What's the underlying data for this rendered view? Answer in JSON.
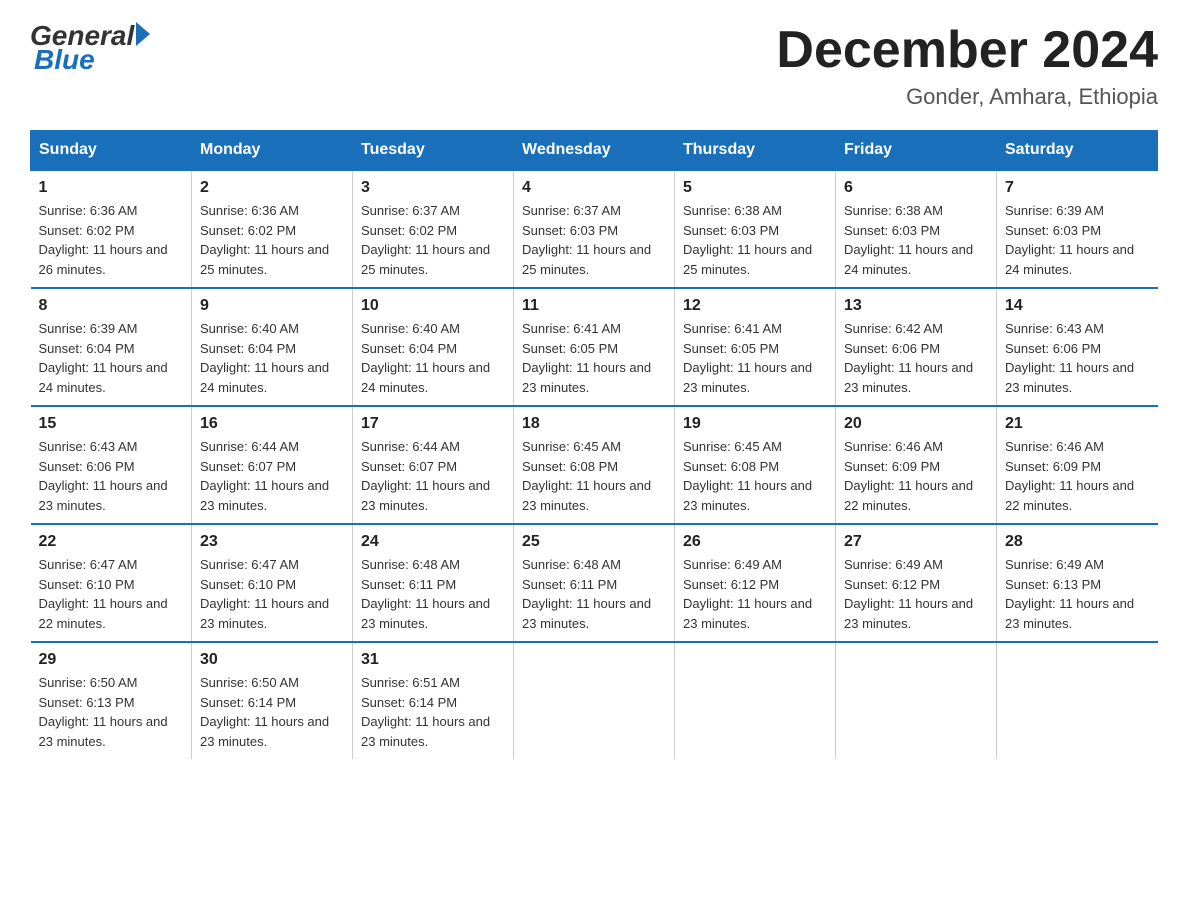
{
  "header": {
    "logo_general": "General",
    "logo_blue": "Blue",
    "month": "December 2024",
    "location": "Gonder, Amhara, Ethiopia"
  },
  "days_of_week": [
    "Sunday",
    "Monday",
    "Tuesday",
    "Wednesday",
    "Thursday",
    "Friday",
    "Saturday"
  ],
  "weeks": [
    [
      {
        "day": "1",
        "sunrise": "6:36 AM",
        "sunset": "6:02 PM",
        "daylight": "11 hours and 26 minutes."
      },
      {
        "day": "2",
        "sunrise": "6:36 AM",
        "sunset": "6:02 PM",
        "daylight": "11 hours and 25 minutes."
      },
      {
        "day": "3",
        "sunrise": "6:37 AM",
        "sunset": "6:02 PM",
        "daylight": "11 hours and 25 minutes."
      },
      {
        "day": "4",
        "sunrise": "6:37 AM",
        "sunset": "6:03 PM",
        "daylight": "11 hours and 25 minutes."
      },
      {
        "day": "5",
        "sunrise": "6:38 AM",
        "sunset": "6:03 PM",
        "daylight": "11 hours and 25 minutes."
      },
      {
        "day": "6",
        "sunrise": "6:38 AM",
        "sunset": "6:03 PM",
        "daylight": "11 hours and 24 minutes."
      },
      {
        "day": "7",
        "sunrise": "6:39 AM",
        "sunset": "6:03 PM",
        "daylight": "11 hours and 24 minutes."
      }
    ],
    [
      {
        "day": "8",
        "sunrise": "6:39 AM",
        "sunset": "6:04 PM",
        "daylight": "11 hours and 24 minutes."
      },
      {
        "day": "9",
        "sunrise": "6:40 AM",
        "sunset": "6:04 PM",
        "daylight": "11 hours and 24 minutes."
      },
      {
        "day": "10",
        "sunrise": "6:40 AM",
        "sunset": "6:04 PM",
        "daylight": "11 hours and 24 minutes."
      },
      {
        "day": "11",
        "sunrise": "6:41 AM",
        "sunset": "6:05 PM",
        "daylight": "11 hours and 23 minutes."
      },
      {
        "day": "12",
        "sunrise": "6:41 AM",
        "sunset": "6:05 PM",
        "daylight": "11 hours and 23 minutes."
      },
      {
        "day": "13",
        "sunrise": "6:42 AM",
        "sunset": "6:06 PM",
        "daylight": "11 hours and 23 minutes."
      },
      {
        "day": "14",
        "sunrise": "6:43 AM",
        "sunset": "6:06 PM",
        "daylight": "11 hours and 23 minutes."
      }
    ],
    [
      {
        "day": "15",
        "sunrise": "6:43 AM",
        "sunset": "6:06 PM",
        "daylight": "11 hours and 23 minutes."
      },
      {
        "day": "16",
        "sunrise": "6:44 AM",
        "sunset": "6:07 PM",
        "daylight": "11 hours and 23 minutes."
      },
      {
        "day": "17",
        "sunrise": "6:44 AM",
        "sunset": "6:07 PM",
        "daylight": "11 hours and 23 minutes."
      },
      {
        "day": "18",
        "sunrise": "6:45 AM",
        "sunset": "6:08 PM",
        "daylight": "11 hours and 23 minutes."
      },
      {
        "day": "19",
        "sunrise": "6:45 AM",
        "sunset": "6:08 PM",
        "daylight": "11 hours and 23 minutes."
      },
      {
        "day": "20",
        "sunrise": "6:46 AM",
        "sunset": "6:09 PM",
        "daylight": "11 hours and 22 minutes."
      },
      {
        "day": "21",
        "sunrise": "6:46 AM",
        "sunset": "6:09 PM",
        "daylight": "11 hours and 22 minutes."
      }
    ],
    [
      {
        "day": "22",
        "sunrise": "6:47 AM",
        "sunset": "6:10 PM",
        "daylight": "11 hours and 22 minutes."
      },
      {
        "day": "23",
        "sunrise": "6:47 AM",
        "sunset": "6:10 PM",
        "daylight": "11 hours and 23 minutes."
      },
      {
        "day": "24",
        "sunrise": "6:48 AM",
        "sunset": "6:11 PM",
        "daylight": "11 hours and 23 minutes."
      },
      {
        "day": "25",
        "sunrise": "6:48 AM",
        "sunset": "6:11 PM",
        "daylight": "11 hours and 23 minutes."
      },
      {
        "day": "26",
        "sunrise": "6:49 AM",
        "sunset": "6:12 PM",
        "daylight": "11 hours and 23 minutes."
      },
      {
        "day": "27",
        "sunrise": "6:49 AM",
        "sunset": "6:12 PM",
        "daylight": "11 hours and 23 minutes."
      },
      {
        "day": "28",
        "sunrise": "6:49 AM",
        "sunset": "6:13 PM",
        "daylight": "11 hours and 23 minutes."
      }
    ],
    [
      {
        "day": "29",
        "sunrise": "6:50 AM",
        "sunset": "6:13 PM",
        "daylight": "11 hours and 23 minutes."
      },
      {
        "day": "30",
        "sunrise": "6:50 AM",
        "sunset": "6:14 PM",
        "daylight": "11 hours and 23 minutes."
      },
      {
        "day": "31",
        "sunrise": "6:51 AM",
        "sunset": "6:14 PM",
        "daylight": "11 hours and 23 minutes."
      },
      null,
      null,
      null,
      null
    ]
  ]
}
